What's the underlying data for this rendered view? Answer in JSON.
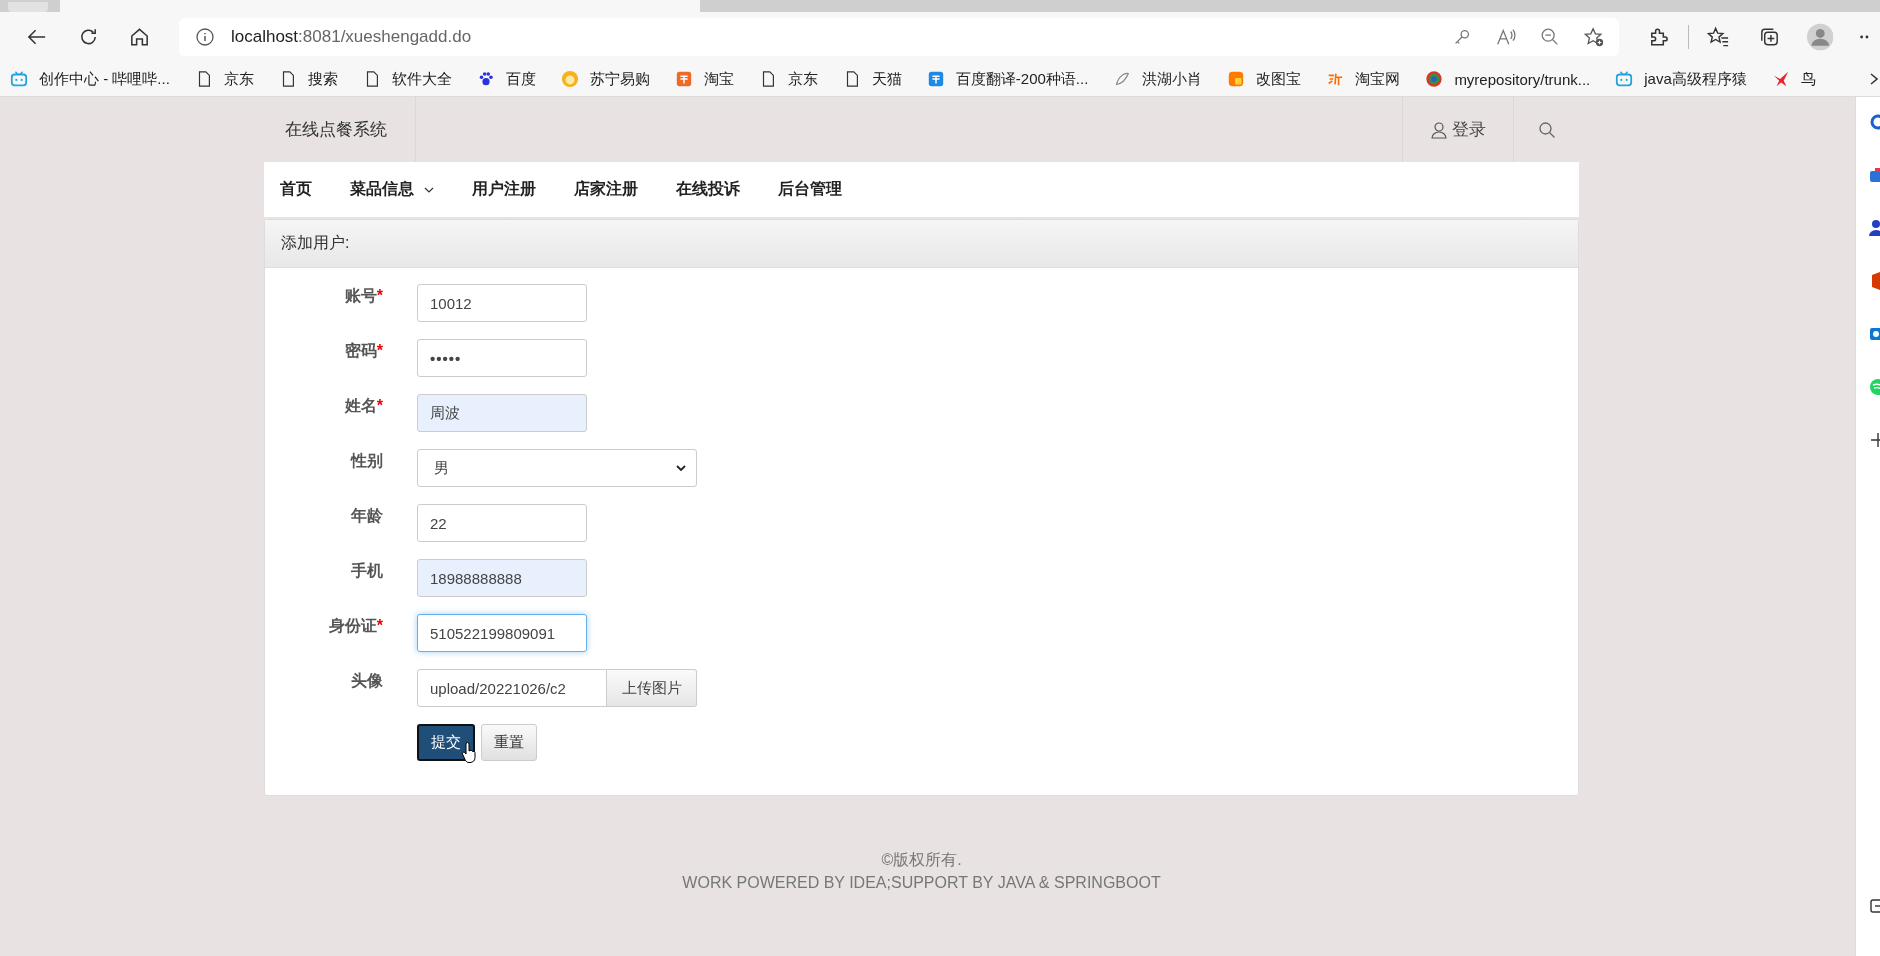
{
  "browser": {
    "address": {
      "host": "localhost",
      "rest": ":8081/xueshengadd.do"
    },
    "bookmarks": [
      {
        "label": "创作中心 - 哔哩哔...",
        "kind": "tv"
      },
      {
        "label": "京东",
        "kind": "page"
      },
      {
        "label": "搜索",
        "kind": "page"
      },
      {
        "label": "软件大全",
        "kind": "page"
      },
      {
        "label": "百度",
        "kind": "paw"
      },
      {
        "label": "苏宁易购",
        "kind": "sun"
      },
      {
        "label": "淘宝",
        "kind": "tile"
      },
      {
        "label": "京东",
        "kind": "page"
      },
      {
        "label": "天猫",
        "kind": "page"
      },
      {
        "label": "百度翻译-200种语...",
        "kind": "tile"
      },
      {
        "label": "洪湖小肖",
        "kind": "mascot"
      },
      {
        "label": "改图宝",
        "kind": "square"
      },
      {
        "label": "淘宝网",
        "kind": "glyph"
      },
      {
        "label": "myrepository/trunk...",
        "kind": "ring"
      },
      {
        "label": "java高级程序猿",
        "kind": "tv"
      },
      {
        "label": "鸟",
        "kind": "bird"
      }
    ]
  },
  "site": {
    "brand": "在线点餐系统",
    "login": "登录",
    "nav": [
      {
        "label": "首页",
        "dropdown": false
      },
      {
        "label": "菜品信息",
        "dropdown": true
      },
      {
        "label": "用户注册",
        "dropdown": false
      },
      {
        "label": "店家注册",
        "dropdown": false
      },
      {
        "label": "在线投诉",
        "dropdown": false
      },
      {
        "label": "后台管理",
        "dropdown": false
      }
    ]
  },
  "panel": {
    "title": "添加用户:",
    "fields": [
      {
        "label": "账号",
        "required_mark": "*",
        "kind": "text",
        "value": "10012",
        "autofilled": false,
        "focused": false
      },
      {
        "label": "密码",
        "required_mark": "*",
        "kind": "password",
        "value": "•••••",
        "autofilled": false,
        "focused": false
      },
      {
        "label": "姓名",
        "required_mark": "*",
        "kind": "text",
        "value": "周波",
        "autofilled": true,
        "focused": false
      },
      {
        "label": "性别",
        "kind": "select",
        "value": "男",
        "autofilled": false,
        "focused": false
      },
      {
        "label": "年龄",
        "kind": "text",
        "value": "22",
        "autofilled": false,
        "focused": false
      },
      {
        "label": "手机",
        "kind": "text",
        "value": "18988888888",
        "autofilled": true,
        "focused": false
      },
      {
        "label": "身份证",
        "required_mark": "*",
        "kind": "text",
        "value": "510522199809091",
        "autofilled": false,
        "focused": true
      },
      {
        "label": "头像",
        "kind": "file",
        "value": "upload/20221026/c2",
        "button": "上传图片",
        "autofilled": false,
        "focused": false
      }
    ],
    "buttons": [
      {
        "label": "提交",
        "kind": "primary"
      },
      {
        "label": "重置",
        "kind": "default"
      }
    ]
  },
  "footer": [
    "©版权所有.",
    "WORK POWERED BY IDEA;SUPPORT BY JAVA & SPRINGBOOT"
  ]
}
